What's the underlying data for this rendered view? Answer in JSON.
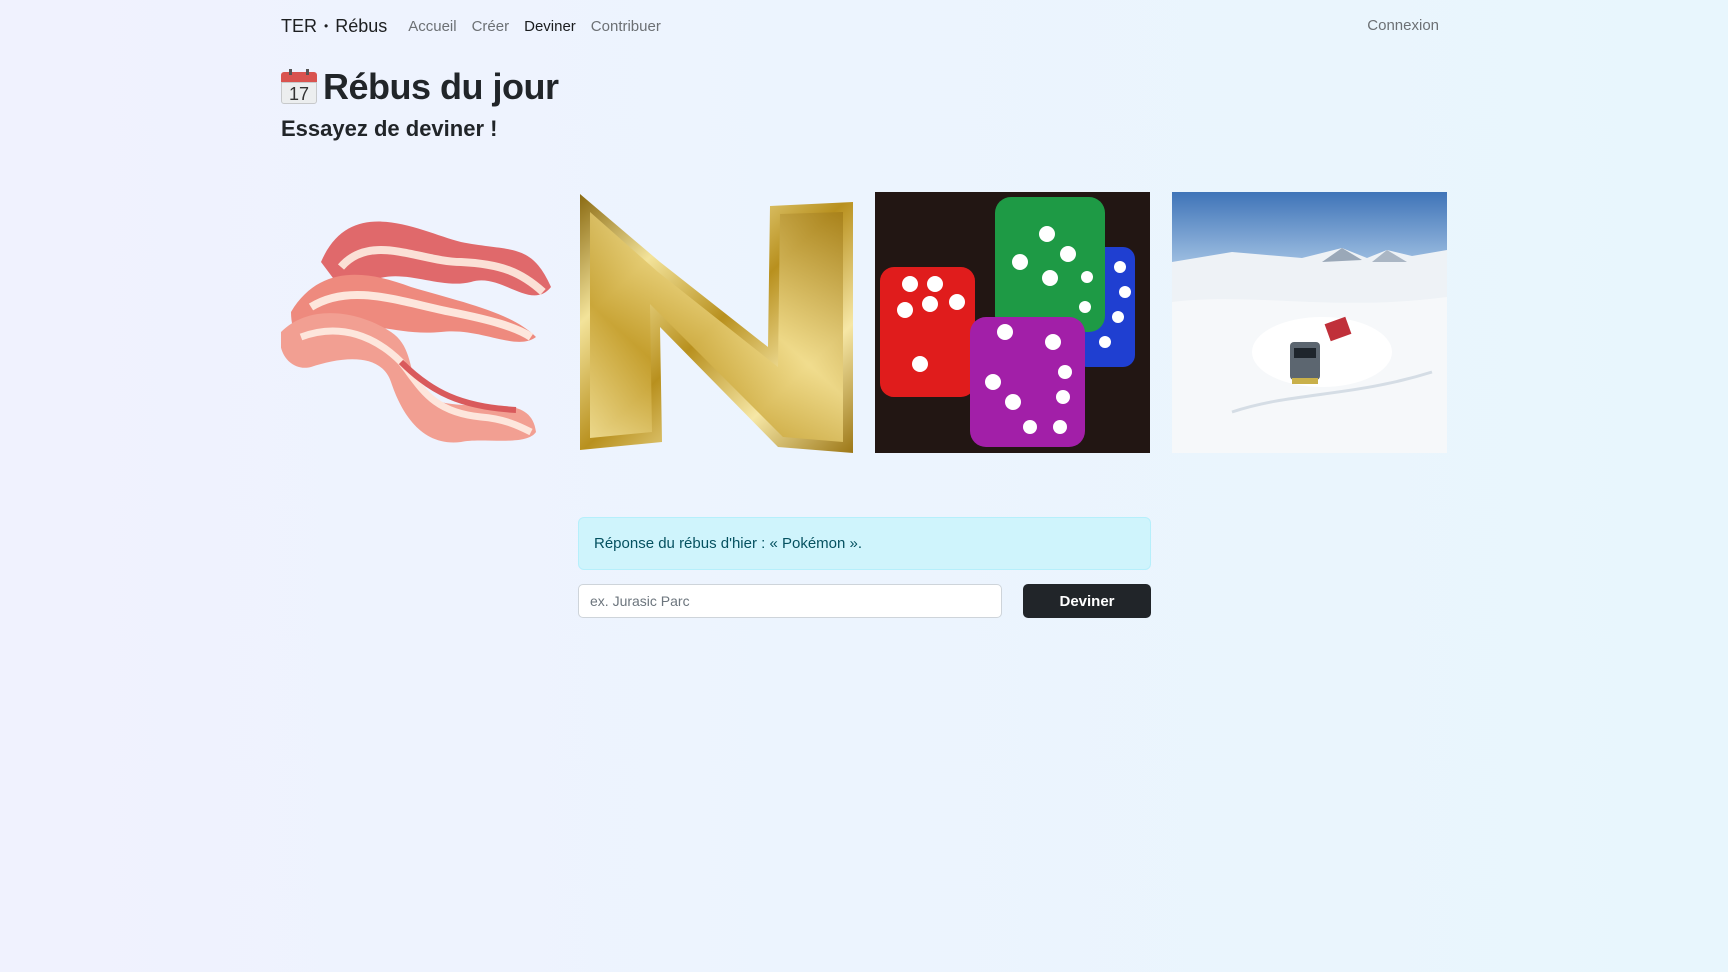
{
  "navbar": {
    "brand_left": "TER",
    "brand_sep": "•",
    "brand_right": "Rébus",
    "links": [
      {
        "label": "Accueil",
        "active": false
      },
      {
        "label": "Créer",
        "active": false
      },
      {
        "label": "Deviner",
        "active": true
      },
      {
        "label": "Contribuer",
        "active": false
      }
    ],
    "login": "Connexion"
  },
  "heading": {
    "icon": "calendar-icon",
    "calendar_day": "17",
    "title": "Rébus du jour",
    "subtitle": "Essayez de deviner !"
  },
  "pictures": [
    {
      "name": "bacon-image"
    },
    {
      "name": "gold-letter-n-image"
    },
    {
      "name": "dice-image"
    },
    {
      "name": "snow-train-image"
    }
  ],
  "alert": {
    "text": "Réponse du rébus d'hier : « Pokémon »."
  },
  "guess": {
    "placeholder": "ex. Jurasic Parc",
    "value": "",
    "button_label": "Deviner"
  },
  "colors": {
    "alert_bg": "#cff4fc",
    "button_bg": "#212529"
  }
}
